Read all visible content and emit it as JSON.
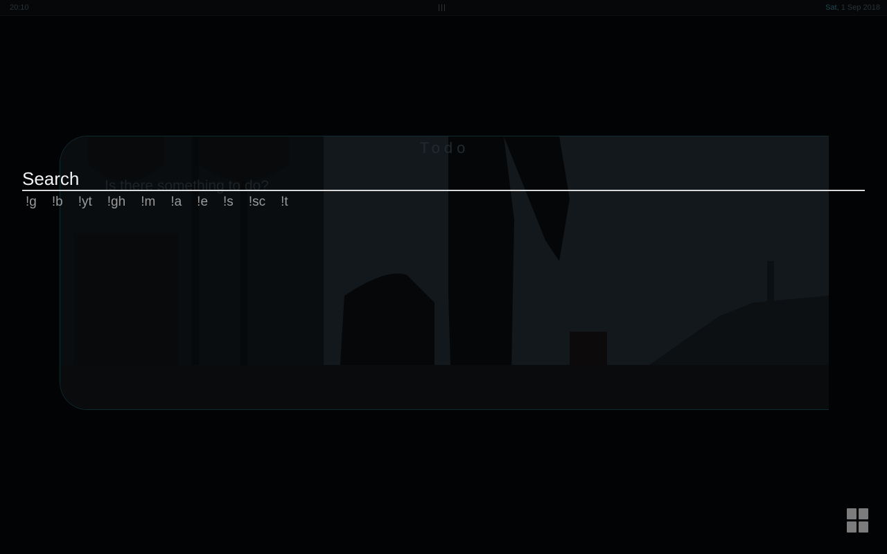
{
  "status_bar": {
    "time": "20:10",
    "day": "Sat,",
    "date": "1 Sep 2018"
  },
  "background_widget": {
    "title": "Todo",
    "placeholder": "Is there something to do?"
  },
  "search": {
    "placeholder": "Search",
    "value": "",
    "bangs": [
      "!g",
      "!b",
      "!yt",
      "!gh",
      "!m",
      "!a",
      "!e",
      "!s",
      "!sc",
      "!t"
    ]
  },
  "app_drawer": {
    "icon": "grid-icon"
  },
  "colors": {
    "background": "#020304",
    "search_underline": "#d9d9d9",
    "bang_text": "#9a9a9a",
    "status_day": "#1b4a53",
    "widget_border": "#0f2b30"
  }
}
